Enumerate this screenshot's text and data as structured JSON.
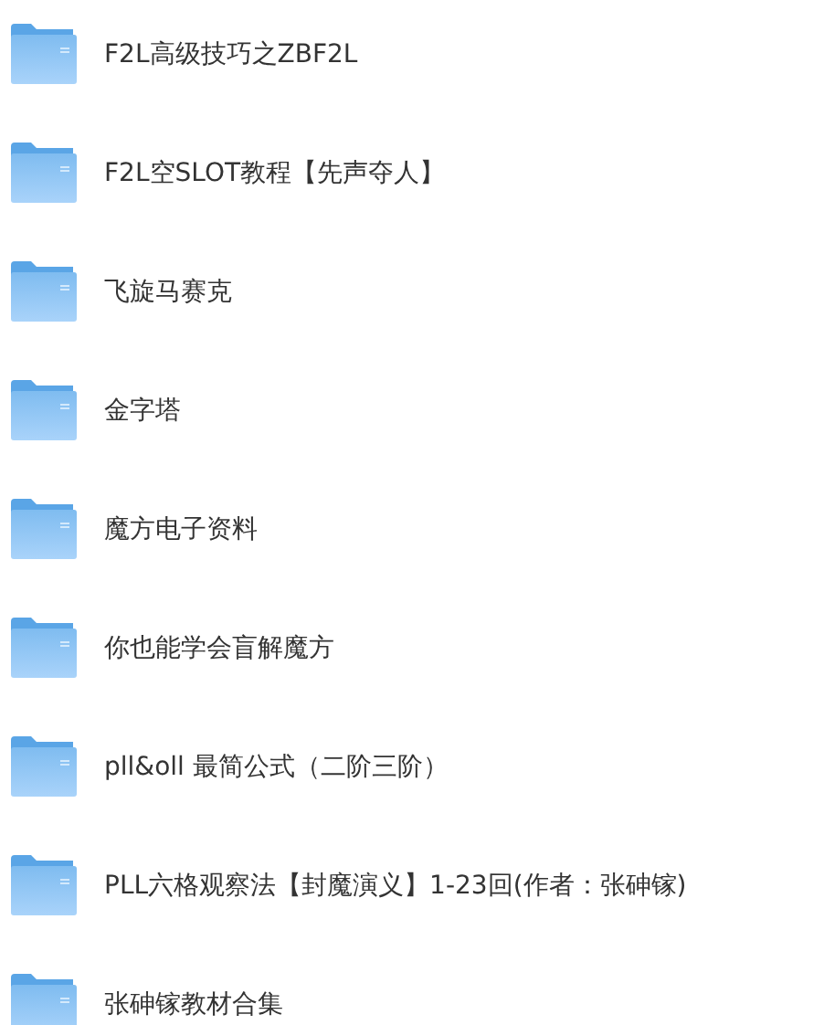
{
  "folders": [
    {
      "name": "F2L高级技巧之ZBF2L"
    },
    {
      "name": "F2L空SLOT教程【先声夺人】"
    },
    {
      "name": "飞旋马赛克"
    },
    {
      "name": "金字塔"
    },
    {
      "name": "魔方电子资料"
    },
    {
      "name": "你也能学会盲解魔方"
    },
    {
      "name": "pll&oll 最简公式（二阶三阶）"
    },
    {
      "name": "PLL六格观察法【封魔演义】1-23回(作者：张砷镓)"
    },
    {
      "name": "张砷镓教材合集"
    }
  ]
}
